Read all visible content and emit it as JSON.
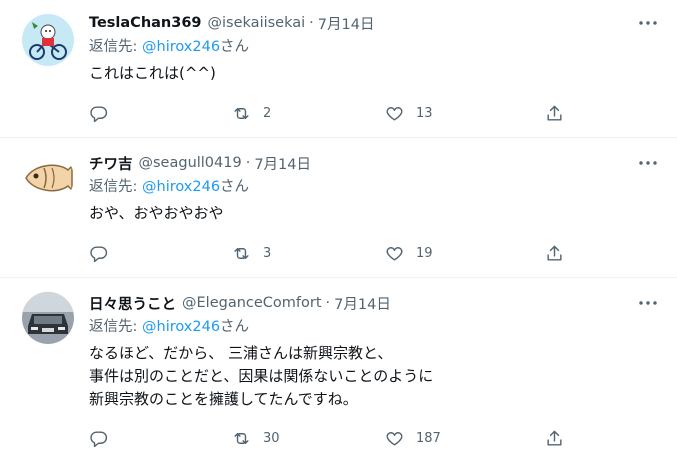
{
  "reply_label": "返信先:",
  "tweets": [
    {
      "name": "TeslaChan369",
      "handle": "@isekaiisekai",
      "separator": "·",
      "date": "7月14日",
      "reply_to": "@hirox246",
      "reply_suffix": "さん",
      "text": [
        "これはこれは(^^)"
      ],
      "retweets": "2",
      "likes": "13",
      "avatar_icon": "bicycle-bear-avatar"
    },
    {
      "name": "チワ吉",
      "handle": "@seagull0419",
      "separator": "·",
      "date": "7月14日",
      "reply_to": "@hirox246",
      "reply_suffix": "さん",
      "text": [
        "おや、おやおやおや"
      ],
      "retweets": "3",
      "likes": "19",
      "avatar_icon": "fish-avatar"
    },
    {
      "name": "日々思うこと",
      "handle": "@EleganceComfort",
      "separator": "·",
      "date": "7月14日",
      "reply_to": "@hirox246",
      "reply_suffix": "さん",
      "text": [
        "なるほど、だから、 三浦さんは新興宗教と、",
        "事件は別のことだと、因果は関係ないことのように",
        "新興宗教のことを擁護してたんですね。"
      ],
      "retweets": "30",
      "likes": "187",
      "avatar_icon": "car-avatar"
    }
  ],
  "colors": {
    "link": "#1d9bf0",
    "secondary_text": "#536471",
    "primary_text": "#0f1419",
    "divider": "#eff3f4"
  }
}
